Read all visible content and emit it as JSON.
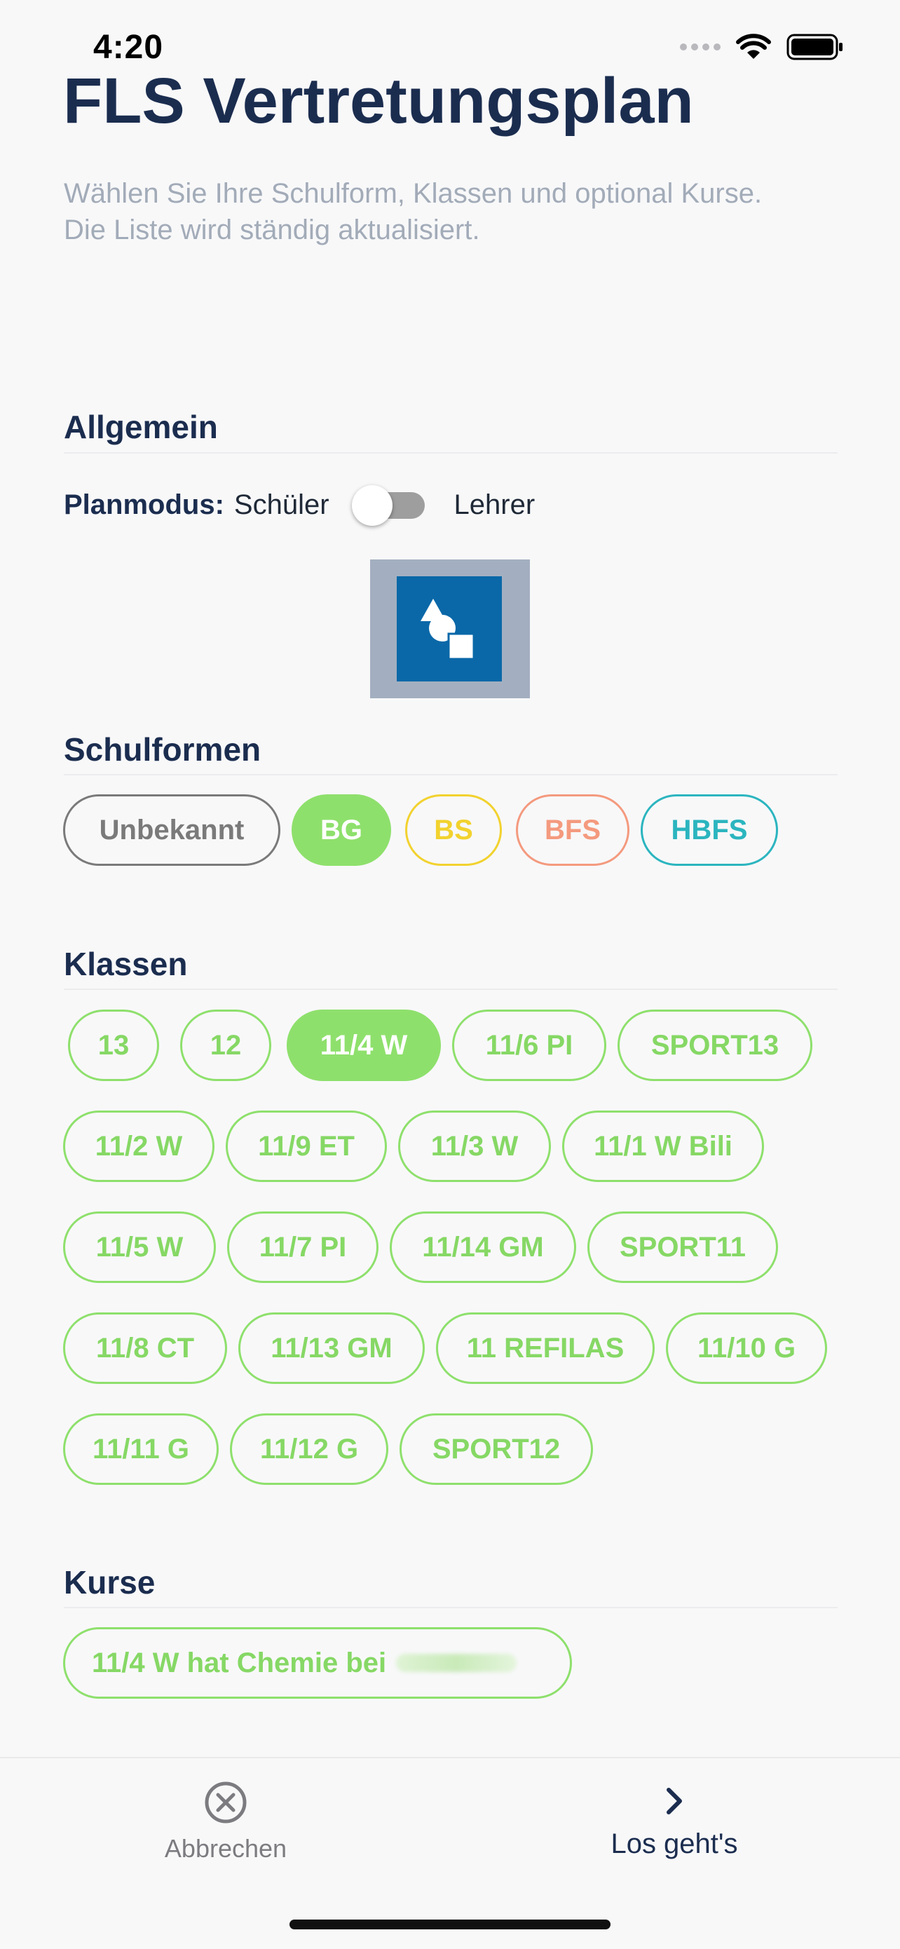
{
  "status_bar": {
    "time": "4:20"
  },
  "header": {
    "title": "FLS Vertretungsplan",
    "subtitle_line1": "Wählen Sie Ihre Schulform, Klassen und optional Kurse.",
    "subtitle_line2": "Die Liste wird ständig aktualisiert."
  },
  "allgemein": {
    "title": "Allgemein",
    "planmodus_label": "Planmodus:",
    "option_left": "Schüler",
    "option_right": "Lehrer",
    "toggle_on": false
  },
  "schulformen": {
    "title": "Schulformen",
    "items": [
      {
        "label": "Unbekannt",
        "color": "#7a7a7a",
        "selected": false
      },
      {
        "label": "BG",
        "color": "#8ee06c",
        "selected": true
      },
      {
        "label": "BS",
        "color": "#f2d22e",
        "selected": false
      },
      {
        "label": "BFS",
        "color": "#f49a7e",
        "selected": false
      },
      {
        "label": "HBFS",
        "color": "#2bb5bf",
        "selected": false
      }
    ]
  },
  "klassen": {
    "title": "Klassen",
    "items": [
      {
        "label": "13",
        "selected": false
      },
      {
        "label": "12",
        "selected": false
      },
      {
        "label": "11/4 W",
        "selected": true
      },
      {
        "label": "11/6 PI",
        "selected": false
      },
      {
        "label": "SPORT13",
        "selected": false
      },
      {
        "label": "11/2 W",
        "selected": false
      },
      {
        "label": "11/9 ET",
        "selected": false
      },
      {
        "label": "11/3 W",
        "selected": false
      },
      {
        "label": "11/1 W Bili",
        "selected": false
      },
      {
        "label": "11/5 W",
        "selected": false
      },
      {
        "label": "11/7 PI",
        "selected": false
      },
      {
        "label": "11/14 GM",
        "selected": false
      },
      {
        "label": "SPORT11",
        "selected": false
      },
      {
        "label": "11/8 CT",
        "selected": false
      },
      {
        "label": "11/13 GM",
        "selected": false
      },
      {
        "label": "11 REFILAS",
        "selected": false
      },
      {
        "label": "11/10 G",
        "selected": false
      },
      {
        "label": "11/11 G",
        "selected": false
      },
      {
        "label": "11/12 G",
        "selected": false
      },
      {
        "label": "SPORT12",
        "selected": false
      }
    ]
  },
  "kurse": {
    "title": "Kurse",
    "items": [
      {
        "label": "11/4 W hat Chemie bei"
      }
    ]
  },
  "bottom_bar": {
    "cancel_label": "Abbrechen",
    "cancel_icon": "close-circle-icon",
    "go_label": "Los geht's",
    "go_icon": "chevron-right-icon"
  },
  "colors": {
    "accent": "#8ee06c",
    "title": "#1b2d4f",
    "subtitle": "#a2abb8"
  }
}
